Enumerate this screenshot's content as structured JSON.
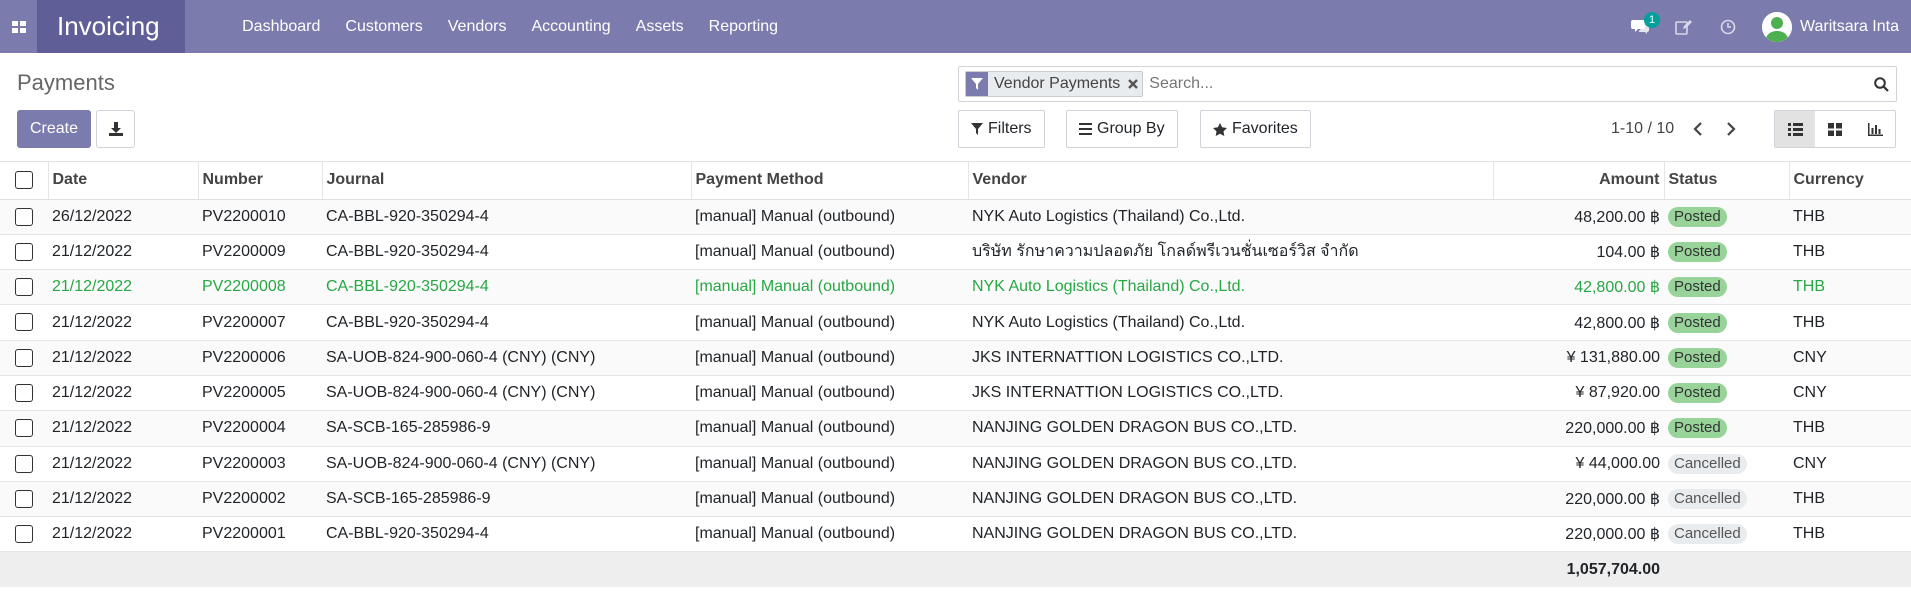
{
  "navbar": {
    "app_name": "Invoicing",
    "menu": [
      "Dashboard",
      "Customers",
      "Vendors",
      "Accounting",
      "Assets",
      "Reporting"
    ],
    "message_count": "1",
    "user_name": "Waritsara Inta",
    "color": "#7c7bad",
    "brand_color": "#5f5e97"
  },
  "control": {
    "title": "Payments",
    "create_label": "Create",
    "facet_label": "Vendor Payments",
    "search_placeholder": "Search...",
    "filters_label": "Filters",
    "groupby_label": "Group By",
    "favorites_label": "Favorites",
    "pager": "1-10 / 10"
  },
  "table": {
    "headers": {
      "date": "Date",
      "number": "Number",
      "journal": "Journal",
      "method": "Payment Method",
      "vendor": "Vendor",
      "amount": "Amount",
      "status": "Status",
      "currency": "Currency"
    },
    "rows": [
      {
        "date": "26/12/2022",
        "number": "PV2200010",
        "journal": "CA-BBL-920-350294-4",
        "method": "[manual] Manual (outbound)",
        "vendor": "NYK Auto Logistics (Thailand) Co.,Ltd.",
        "amount": "48,200.00 ฿",
        "status": "Posted",
        "currency": "THB"
      },
      {
        "date": "21/12/2022",
        "number": "PV2200009",
        "journal": "CA-BBL-920-350294-4",
        "method": "[manual] Manual (outbound)",
        "vendor": "บริษัท รักษาความปลอดภัย โกลด์พรีเวนชั่นเซอร์วิส จำกัด",
        "amount": "104.00 ฿",
        "status": "Posted",
        "currency": "THB"
      },
      {
        "date": "21/12/2022",
        "number": "PV2200008",
        "journal": "CA-BBL-920-350294-4",
        "method": "[manual] Manual (outbound)",
        "vendor": "NYK Auto Logistics (Thailand) Co.,Ltd.",
        "amount": "42,800.00 ฿",
        "status": "Posted",
        "currency": "THB",
        "highlight": true
      },
      {
        "date": "21/12/2022",
        "number": "PV2200007",
        "journal": "CA-BBL-920-350294-4",
        "method": "[manual] Manual (outbound)",
        "vendor": "NYK Auto Logistics (Thailand) Co.,Ltd.",
        "amount": "42,800.00 ฿",
        "status": "Posted",
        "currency": "THB"
      },
      {
        "date": "21/12/2022",
        "number": "PV2200006",
        "journal": "SA-UOB-824-900-060-4 (CNY) (CNY)",
        "method": "[manual] Manual (outbound)",
        "vendor": "JKS INTERNATTION LOGISTICS CO.,LTD.",
        "amount": "¥ 131,880.00",
        "status": "Posted",
        "currency": "CNY"
      },
      {
        "date": "21/12/2022",
        "number": "PV2200005",
        "journal": "SA-UOB-824-900-060-4 (CNY) (CNY)",
        "method": "[manual] Manual (outbound)",
        "vendor": "JKS INTERNATTION LOGISTICS CO.,LTD.",
        "amount": "¥ 87,920.00",
        "status": "Posted",
        "currency": "CNY"
      },
      {
        "date": "21/12/2022",
        "number": "PV2200004",
        "journal": "SA-SCB-165-285986-9",
        "method": "[manual] Manual (outbound)",
        "vendor": "NANJING GOLDEN DRAGON BUS CO.,LTD.",
        "amount": "220,000.00 ฿",
        "status": "Posted",
        "currency": "THB"
      },
      {
        "date": "21/12/2022",
        "number": "PV2200003",
        "journal": "SA-UOB-824-900-060-4 (CNY) (CNY)",
        "method": "[manual] Manual (outbound)",
        "vendor": "NANJING GOLDEN DRAGON BUS CO.,LTD.",
        "amount": "¥ 44,000.00",
        "status": "Cancelled",
        "currency": "CNY"
      },
      {
        "date": "21/12/2022",
        "number": "PV2200002",
        "journal": "SA-SCB-165-285986-9",
        "method": "[manual] Manual (outbound)",
        "vendor": "NANJING GOLDEN DRAGON BUS CO.,LTD.",
        "amount": "220,000.00 ฿",
        "status": "Cancelled",
        "currency": "THB"
      },
      {
        "date": "21/12/2022",
        "number": "PV2200001",
        "journal": "CA-BBL-920-350294-4",
        "method": "[manual] Manual (outbound)",
        "vendor": "NANJING GOLDEN DRAGON BUS CO.,LTD.",
        "amount": "220,000.00 ฿",
        "status": "Cancelled",
        "currency": "THB"
      }
    ],
    "total": "1,057,704.00"
  }
}
